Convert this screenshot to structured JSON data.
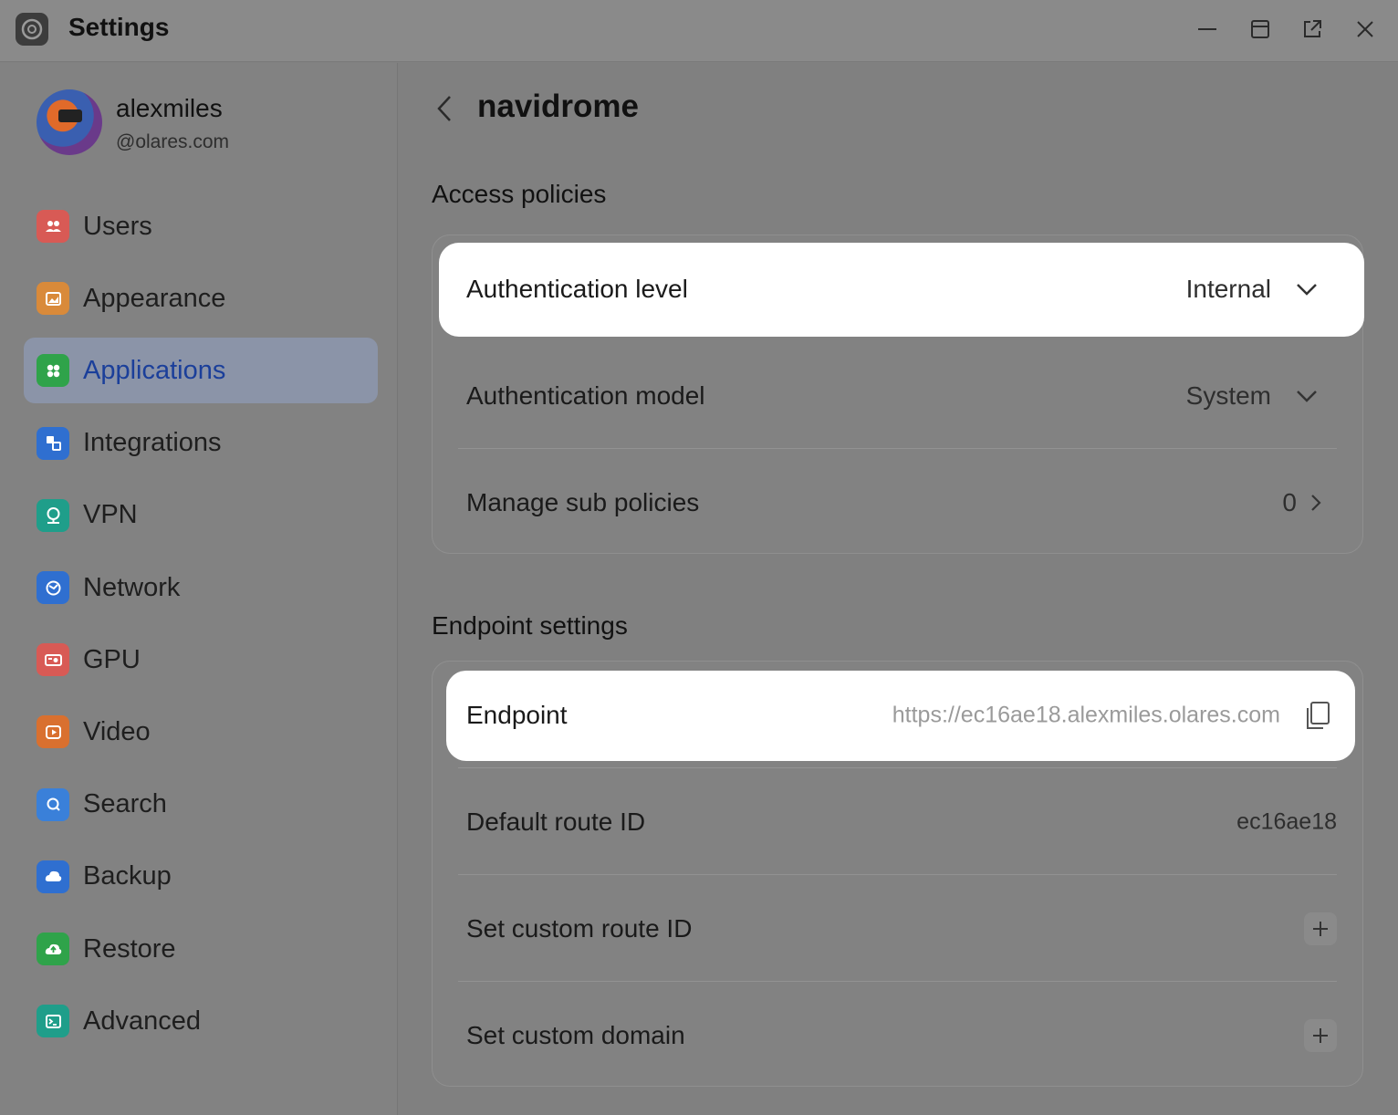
{
  "window": {
    "title": "Settings"
  },
  "user": {
    "name": "alexmiles",
    "domain": "@olares.com"
  },
  "sidebar": {
    "items": [
      {
        "label": "Users",
        "icon": "users-icon",
        "color": "#d85a55"
      },
      {
        "label": "Appearance",
        "icon": "appearance-icon",
        "color": "#d98a3a"
      },
      {
        "label": "Applications",
        "icon": "applications-icon",
        "color": "#2fa34a",
        "active": true
      },
      {
        "label": "Integrations",
        "icon": "integrations-icon",
        "color": "#2f6fd0"
      },
      {
        "label": "VPN",
        "icon": "vpn-icon",
        "color": "#1f9e8a"
      },
      {
        "label": "Network",
        "icon": "network-icon",
        "color": "#2f6fd0"
      },
      {
        "label": "GPU",
        "icon": "gpu-icon",
        "color": "#d85a55"
      },
      {
        "label": "Video",
        "icon": "video-icon",
        "color": "#d9702f"
      },
      {
        "label": "Search",
        "icon": "search-icon",
        "color": "#3a80d9"
      },
      {
        "label": "Backup",
        "icon": "backup-icon",
        "color": "#2f6fd0"
      },
      {
        "label": "Restore",
        "icon": "restore-icon",
        "color": "#2fa34a"
      },
      {
        "label": "Advanced",
        "icon": "advanced-icon",
        "color": "#1f9e8a"
      }
    ]
  },
  "main": {
    "title": "navidrome",
    "access": {
      "title": "Access policies",
      "auth_level_label": "Authentication level",
      "auth_level_value": "Internal",
      "auth_model_label": "Authentication model",
      "auth_model_value": "System",
      "sub_policies_label": "Manage sub policies",
      "sub_policies_count": "0"
    },
    "endpoint": {
      "title": "Endpoint settings",
      "endpoint_label": "Endpoint",
      "endpoint_value": "https://ec16ae18.alexmiles.olares.com",
      "route_label": "Default route ID",
      "route_value": "ec16ae18",
      "custom_route_label": "Set custom route ID",
      "custom_domain_label": "Set custom domain"
    }
  }
}
